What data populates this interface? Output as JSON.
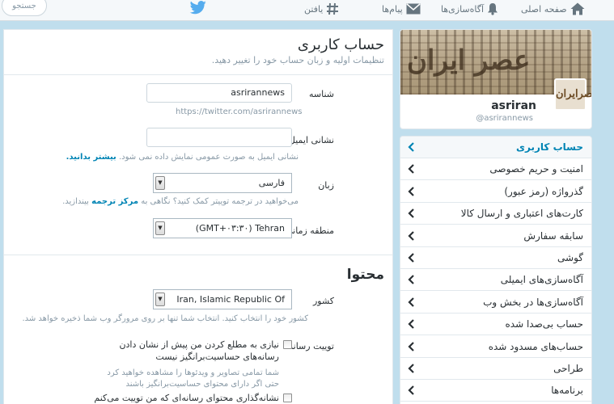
{
  "topbar": {
    "search_placeholder": "جستجو",
    "nav": [
      {
        "label": "صفحه اصلی",
        "icon": "home-icon"
      },
      {
        "label": "آگاه‌سازی‌ها",
        "icon": "bell-icon"
      },
      {
        "label": "پیام‌ها",
        "icon": "envelope-icon"
      },
      {
        "label": "یافتن",
        "icon": "hash-icon"
      }
    ]
  },
  "main": {
    "title": "حساب کاربری",
    "subtitle": "تنظیمات اولیه و زبان حساب خود را تغییر دهید.",
    "username": {
      "label": "شناسه",
      "value": "asrirannews",
      "url_hint": "https://twitter.com/asrirannews"
    },
    "email": {
      "label": "نشانی ایمیل",
      "value": "",
      "hint": "نشانی ایمیل به صورت عمومی نمایش داده نمی شود.",
      "hint_link": "بیشتر بدانید."
    },
    "language": {
      "label": "زبان",
      "value": "فارسی",
      "hint": "می‌خواهید در ترجمه توییتر کمک کنید؟ نگاهی به",
      "hint_link": "مرکز ترجمه",
      "hint_tail": "بیندازید."
    },
    "timezone": {
      "label": "منطقه زمانی",
      "value": "(GMT+۰۳:۳۰) Tehran"
    },
    "content_title": "محتوا",
    "country": {
      "label": "کشور",
      "value": "Iran, Islamic Republic Of",
      "hint": "کشور خود را انتخاب کنید. انتخاب شما تنها بر روی مرورگر وب شما ذخیره خواهد شد."
    },
    "media": {
      "label": "توییت رسانه",
      "option1": "نیازی به مطلع کردن من پیش از نشان دادن رسانه‌های حساسیت‌برانگیز نیست",
      "option1_hint": "شما تمامی تصاویر و ویدئوها را مشاهده خواهید کرد حتی اگر دارای محتوای حساسیت‌برانگیز باشند",
      "option2": "نشانه‌گذاری محتوای رسانه‌ای که من توییت می‌کنم به عنوان محتوایی که"
    }
  },
  "profile": {
    "banner_text": "عصر ایران",
    "avatar_text": "عصرايران",
    "name": "asriran",
    "handle": "@asrirannews"
  },
  "menu": {
    "items": [
      {
        "label": "حساب کاربری",
        "active": true
      },
      {
        "label": "امنیت و حریم خصوصی"
      },
      {
        "label": "گذرواژه (رمز عبور)"
      },
      {
        "label": "کارت‌های اعتباری و ارسال کالا"
      },
      {
        "label": "سابقه سفارش"
      },
      {
        "label": "گوشی"
      },
      {
        "label": "آگاه‌سازی‌های ایمیلی"
      },
      {
        "label": "آگاه‌سازی‌ها در بخش وب"
      },
      {
        "label": "حساب بی‌صدا شده"
      },
      {
        "label": "حساب‌های مسدود شده"
      },
      {
        "label": "طراحی"
      },
      {
        "label": "برنامه‌ها"
      }
    ]
  },
  "colors": {
    "accent": "#0084b4",
    "background": "#c0deed",
    "twitter_blue": "#55acee"
  }
}
